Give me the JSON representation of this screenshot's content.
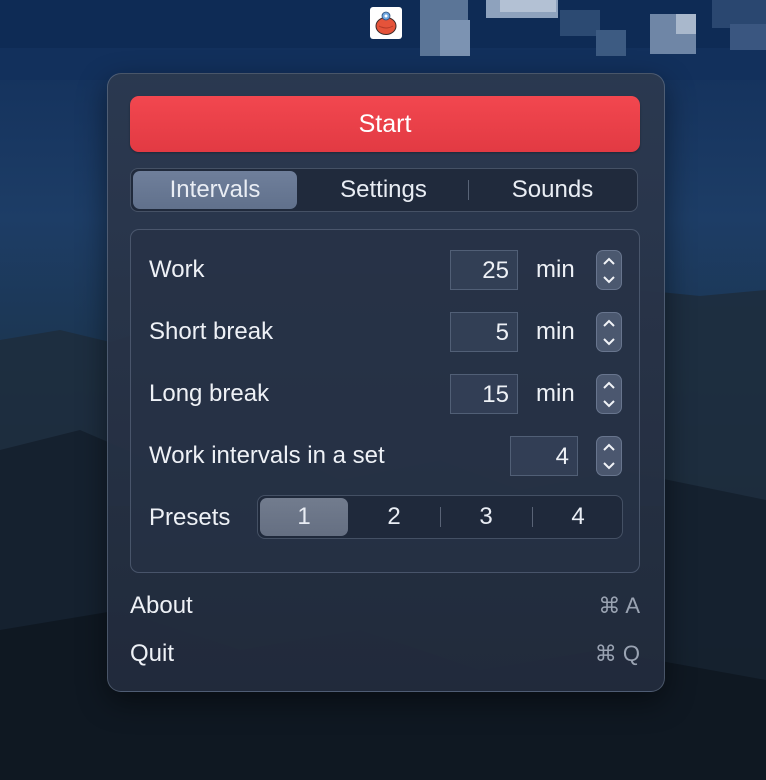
{
  "menubar": {
    "app_icon": "tomato-timer-icon"
  },
  "popover": {
    "start_label": "Start",
    "tabs": [
      {
        "label": "Intervals",
        "selected": true
      },
      {
        "label": "Settings",
        "selected": false
      },
      {
        "label": "Sounds",
        "selected": false
      }
    ],
    "intervals": {
      "rows": [
        {
          "label": "Work",
          "value": "25",
          "unit": "min"
        },
        {
          "label": "Short break",
          "value": "5",
          "unit": "min"
        },
        {
          "label": "Long break",
          "value": "15",
          "unit": "min"
        },
        {
          "label": "Work intervals in a set",
          "value": "4",
          "unit": ""
        }
      ],
      "presets_label": "Presets",
      "presets": [
        "1",
        "2",
        "3",
        "4"
      ],
      "selected_preset": "1"
    },
    "menu": [
      {
        "label": "About",
        "shortcut": "⌘ A"
      },
      {
        "label": "Quit",
        "shortcut": "⌘ Q"
      }
    ]
  },
  "colors": {
    "accent_red": "#e8404a",
    "selected_segment": "#6a7a96",
    "popover_bg": "#2a3650"
  }
}
